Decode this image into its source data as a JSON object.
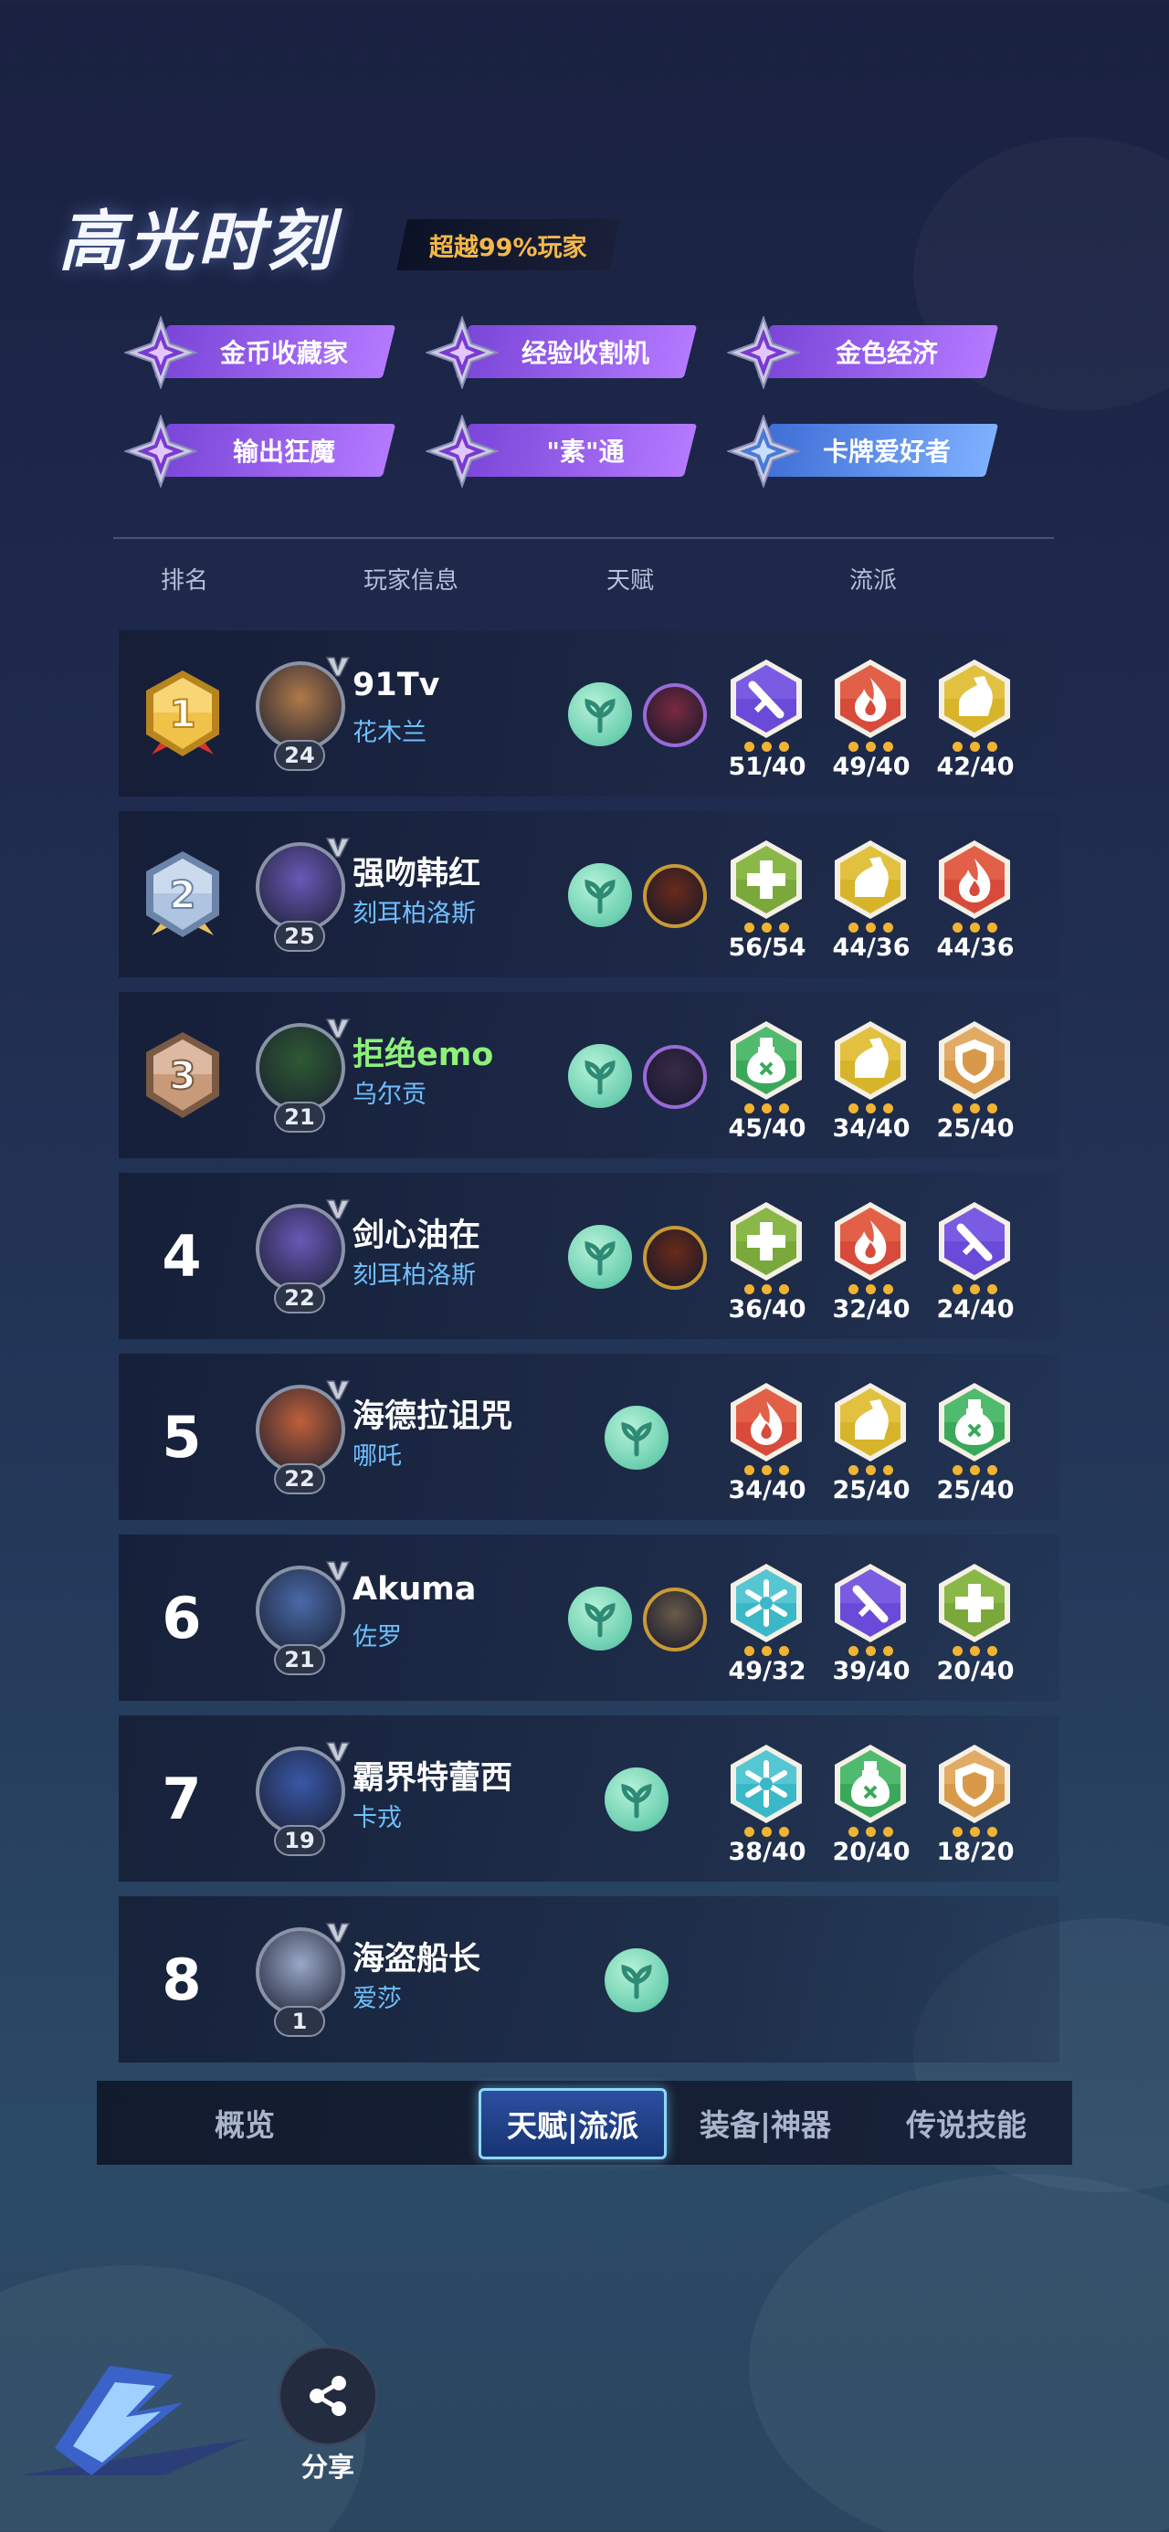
{
  "header": {
    "title": "高光时刻",
    "badge": "超越99%玩家"
  },
  "tags": [
    {
      "label": "金币收藏家",
      "color": "purple"
    },
    {
      "label": "经验收割机",
      "color": "purple"
    },
    {
      "label": "金色经济",
      "color": "purple"
    },
    {
      "label": "输出狂魔",
      "color": "purple"
    },
    {
      "label": "\"素\"通",
      "color": "purple"
    },
    {
      "label": "卡牌爱好者",
      "color": "blue"
    }
  ],
  "columns": {
    "rank": "排名",
    "player": "玩家信息",
    "talent": "天赋",
    "build": "流派"
  },
  "players": [
    {
      "rank": "1",
      "name": "91Tv",
      "hero": "花木兰",
      "level": "24",
      "avatar_color": "#b07a4a",
      "talent_count": 2,
      "hero_icon_color": "#7a2a40",
      "builds": [
        {
          "icon": "sword",
          "color": "purple",
          "value": "51/40"
        },
        {
          "icon": "fire",
          "color": "red",
          "value": "49/40"
        },
        {
          "icon": "arm",
          "color": "yellow",
          "value": "42/40"
        }
      ]
    },
    {
      "rank": "2",
      "name": "强吻韩红",
      "hero": "刻耳柏洛斯",
      "level": "25",
      "avatar_color": "#6a58b8",
      "talent_count": 2,
      "hero_icon_color": "#6a2a1a",
      "builds": [
        {
          "icon": "plus",
          "color": "olive",
          "value": "56/54"
        },
        {
          "icon": "arm",
          "color": "yellow",
          "value": "44/36"
        },
        {
          "icon": "fire",
          "color": "red",
          "value": "44/36"
        }
      ]
    },
    {
      "rank": "3",
      "name": "拒绝emo",
      "hero": "乌尔贡",
      "level": "21",
      "avatar_color": "#2e5a32",
      "name_color": "green",
      "talent_count": 2,
      "hero_icon_color": "#3a2a4a",
      "builds": [
        {
          "icon": "potion",
          "color": "green",
          "value": "45/40"
        },
        {
          "icon": "arm",
          "color": "yellow",
          "value": "34/40"
        },
        {
          "icon": "shield",
          "color": "orange",
          "value": "25/40"
        }
      ]
    },
    {
      "rank": "4",
      "name": "剑心油在",
      "hero": "刻耳柏洛斯",
      "level": "22",
      "avatar_color": "#6a58b8",
      "talent_count": 2,
      "hero_icon_color": "#6a2a1a",
      "builds": [
        {
          "icon": "plus",
          "color": "olive",
          "value": "36/40"
        },
        {
          "icon": "fire",
          "color": "red",
          "value": "32/40"
        },
        {
          "icon": "sword",
          "color": "purple",
          "value": "24/40"
        }
      ]
    },
    {
      "rank": "5",
      "name": "海德拉诅咒",
      "hero": "哪吒",
      "level": "22",
      "avatar_color": "#c0603a",
      "talent_count": 1,
      "builds": [
        {
          "icon": "fire",
          "color": "red",
          "value": "34/40"
        },
        {
          "icon": "arm",
          "color": "yellow",
          "value": "25/40"
        },
        {
          "icon": "potion",
          "color": "green",
          "value": "25/40"
        }
      ]
    },
    {
      "rank": "6",
      "name": "Akuma",
      "hero": "佐罗",
      "level": "21",
      "avatar_color": "#4a6aa8",
      "talent_count": 2,
      "hero_icon_color": "#6a5a4a",
      "builds": [
        {
          "icon": "snow",
          "color": "teal",
          "value": "49/32"
        },
        {
          "icon": "sword",
          "color": "purple",
          "value": "39/40"
        },
        {
          "icon": "plus",
          "color": "olive",
          "value": "20/40"
        }
      ]
    },
    {
      "rank": "7",
      "name": "霸界特蕾西",
      "hero": "卡戎",
      "level": "19",
      "avatar_color": "#3a58a8",
      "talent_count": 1,
      "builds": [
        {
          "icon": "snow",
          "color": "teal",
          "value": "38/40"
        },
        {
          "icon": "potion",
          "color": "green",
          "value": "20/40"
        },
        {
          "icon": "shield",
          "color": "orange",
          "value": "18/20"
        }
      ]
    },
    {
      "rank": "8",
      "name": "海盗船长",
      "hero": "爱莎",
      "level": "1",
      "avatar_color": "#9aa8c8",
      "talent_count": 1,
      "builds": []
    }
  ],
  "tabs": [
    {
      "label": "概览",
      "active": false
    },
    {
      "label": "天赋|流派",
      "active": true
    },
    {
      "label": "装备|神器",
      "active": false
    },
    {
      "label": "传说技能",
      "active": false
    }
  ],
  "footer": {
    "share_label": "分享"
  }
}
